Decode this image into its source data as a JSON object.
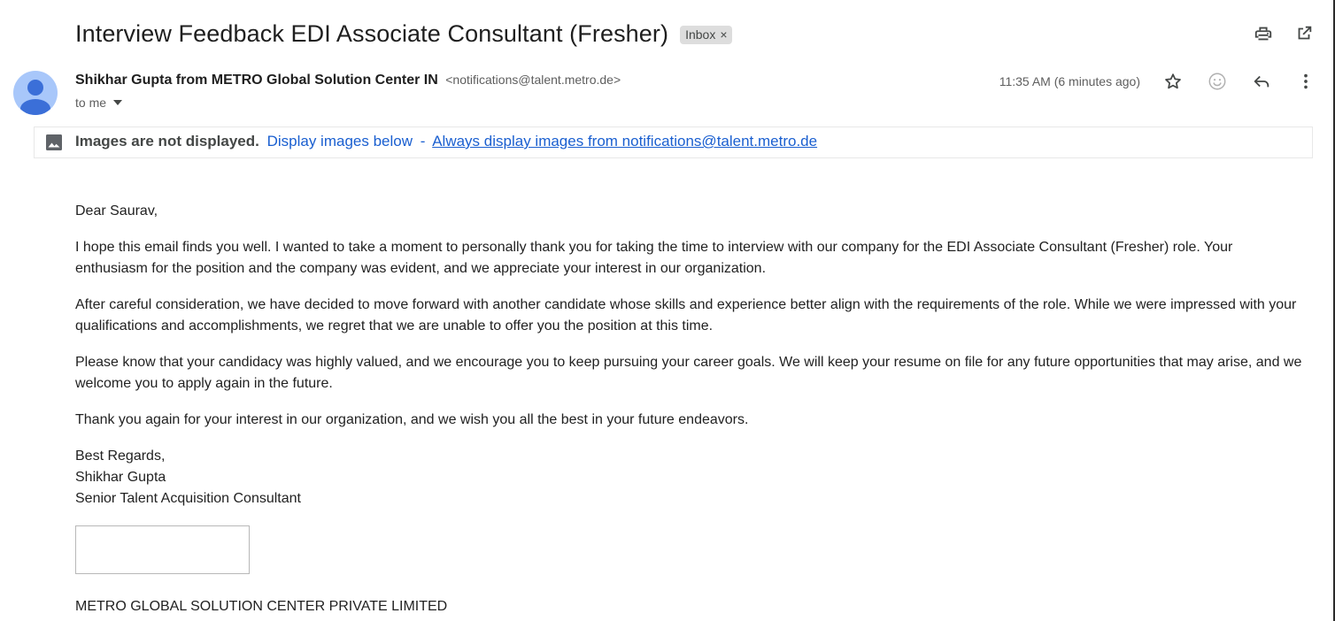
{
  "email": {
    "subject": "Interview Feedback EDI Associate Consultant (Fresher)",
    "label": "Inbox",
    "label_close": "×",
    "sender_name": "Shikhar Gupta from METRO Global Solution Center IN",
    "sender_email": "<notifications@talent.metro.de>",
    "to": "to me",
    "timestamp": "11:35 AM (6 minutes ago)"
  },
  "icons": {
    "print": "printer-icon",
    "popout": "open-in-new-window-icon",
    "star": "star-icon",
    "emoji": "emoji-reaction-icon",
    "reply": "reply-icon",
    "more": "more-vertical-icon",
    "image": "image-icon",
    "avatar": "person-avatar-icon"
  },
  "images_banner": {
    "strong": "Images are not displayed.",
    "display_below": "Display images below",
    "separator": "-",
    "always_display": "Always display images from notifications@talent.metro.de"
  },
  "body": {
    "greeting": "Dear Saurav,",
    "paragraphs": [
      "I hope this email finds you well. I wanted to take a moment to personally thank you for taking the time to interview with our company for the EDI Associate Consultant (Fresher) role. Your enthusiasm for the position and the company was evident, and we appreciate your interest in our organization.",
      "After careful consideration, we have decided to move forward with another candidate whose skills and experience better align with the requirements of the role. While we were impressed with your qualifications and accomplishments, we regret that we are unable to offer you the position at this time.",
      "Please know that your candidacy was highly valued, and we encourage you to keep pursuing your career goals. We will keep your resume on file for any future opportunities that may arise, and we welcome you to apply again in the future.",
      "Thank you again for your interest in our organization, and we wish you all the best in your future endeavors."
    ],
    "signoff": "Best Regards,",
    "sig_name": "Shikhar Gupta",
    "sig_title": "Senior Talent Acquisition Consultant",
    "company": "METRO GLOBAL SOLUTION CENTER PRIVATE LIMITED"
  },
  "colors": {
    "link": "#1a5fd0",
    "avatar_bg": "#a8c7fa",
    "avatar_fg": "#3b6fd8",
    "chip_bg": "#dddddd"
  }
}
